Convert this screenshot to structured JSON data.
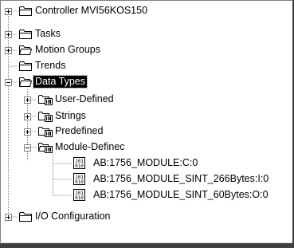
{
  "tree": {
    "items": [
      {
        "label": "Controller MVI56KOS150",
        "icon": "folder-icon",
        "expander": "plus"
      },
      {
        "label": "Tasks",
        "icon": "folder-icon",
        "expander": "plus"
      },
      {
        "label": "Motion Groups",
        "icon": "open-folder-icon",
        "expander": "plus"
      },
      {
        "label": "Trends",
        "icon": "folder-icon",
        "expander": "none"
      },
      {
        "label": "Data Types",
        "icon": "open-folder-icon",
        "expander": "minus",
        "selected": true
      },
      {
        "label": "User-Defined",
        "icon": "datatype-folder-icon",
        "expander": "plus"
      },
      {
        "label": "Strings",
        "icon": "datatype-folder-icon",
        "expander": "plus"
      },
      {
        "label": "Predefined",
        "icon": "datatype-folder-icon",
        "expander": "plus"
      },
      {
        "label": "Module-Definec",
        "icon": "datatype-folder-open-icon",
        "expander": "minus"
      },
      {
        "label": "AB:1756_MODULE:C:0",
        "icon": "binary-data-icon",
        "expander": "none"
      },
      {
        "label": "AB:1756_MODULE_SINT_266Bytes:I:0",
        "icon": "binary-data-icon",
        "expander": "none"
      },
      {
        "label": "AB:1756_MODULE_SINT_60Bytes:O:0",
        "icon": "binary-data-icon",
        "expander": "none"
      },
      {
        "label": "I/O Configuration",
        "icon": "folder-icon",
        "expander": "plus"
      }
    ]
  },
  "colors": {
    "selection_bg": "#000000",
    "selection_fg": "#ffffff",
    "tree_line": "#808080",
    "folder_fill": "#ffffff",
    "folder_stroke": "#000000"
  }
}
